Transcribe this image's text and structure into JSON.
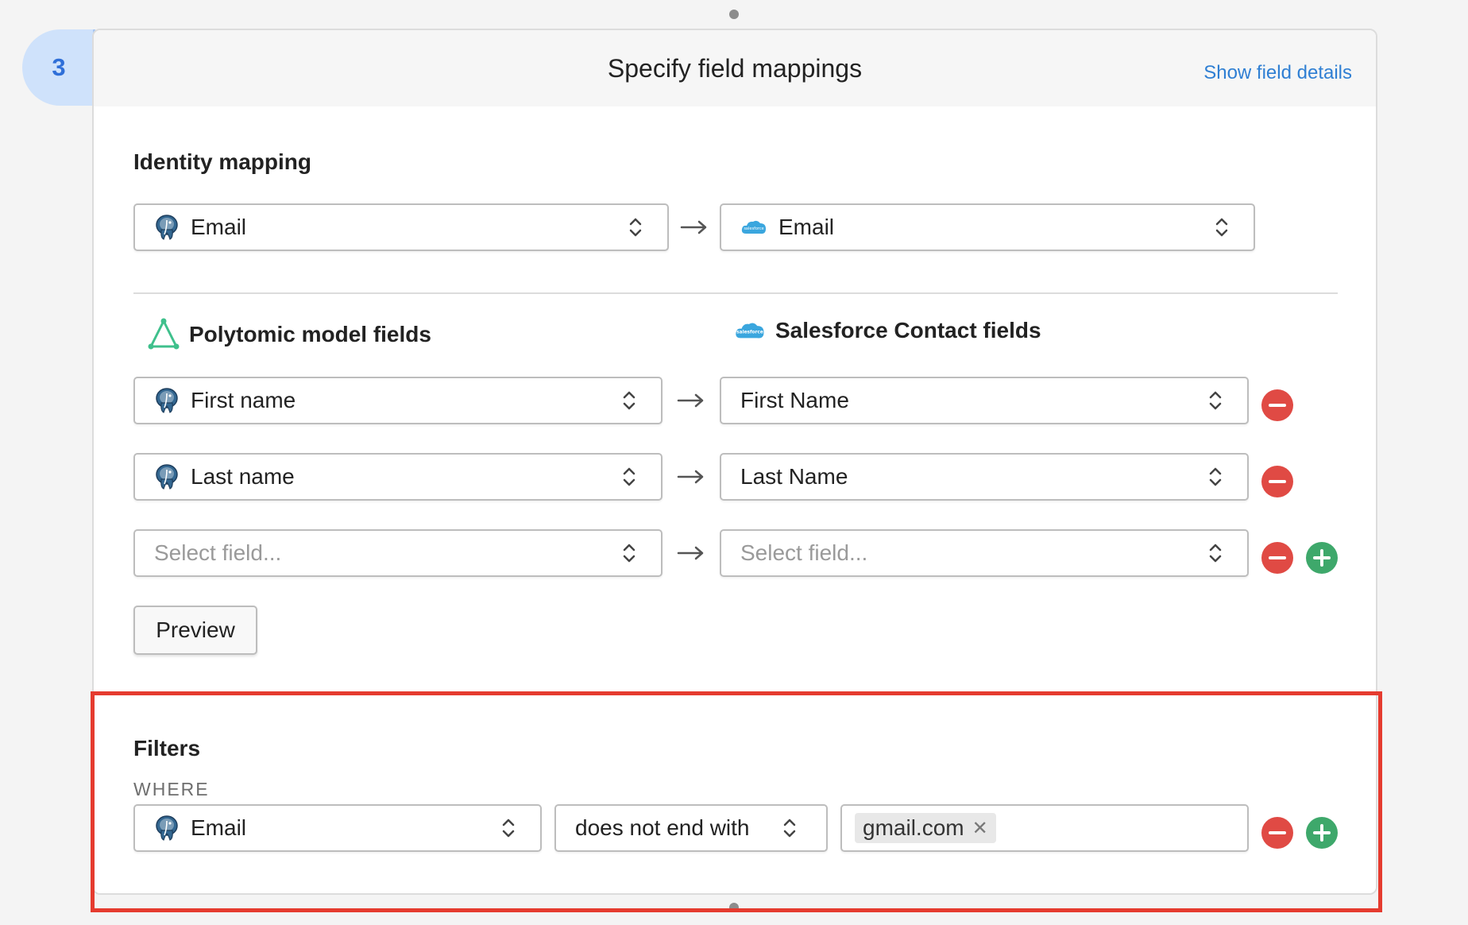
{
  "step": {
    "number": "3"
  },
  "header": {
    "title": "Specify field mappings",
    "show_details": "Show field details"
  },
  "identity": {
    "label": "Identity mapping",
    "source_field": "Email",
    "target_field": "Email"
  },
  "columns": {
    "source_title": "Polytomic model fields",
    "target_title": "Salesforce Contact fields"
  },
  "mappings": [
    {
      "source": "First name",
      "target": "First Name"
    },
    {
      "source": "Last name",
      "target": "Last Name"
    },
    {
      "source_placeholder": "Select field...",
      "target_placeholder": "Select field..."
    }
  ],
  "preview_label": "Preview",
  "filters": {
    "label": "Filters",
    "where_label": "WHERE",
    "field": "Email",
    "operator": "does not end with",
    "values": [
      "gmail.com"
    ]
  },
  "colors": {
    "accent": "#2f7fd3",
    "remove": "#e04a44",
    "add": "#3ea86b",
    "highlight": "#e53b2f",
    "badge": "#cfe2fb"
  },
  "icons": {
    "source_db": "postgres-elephant-icon",
    "target_crm": "salesforce-cloud-icon",
    "model": "polytomic-triangle-icon"
  }
}
